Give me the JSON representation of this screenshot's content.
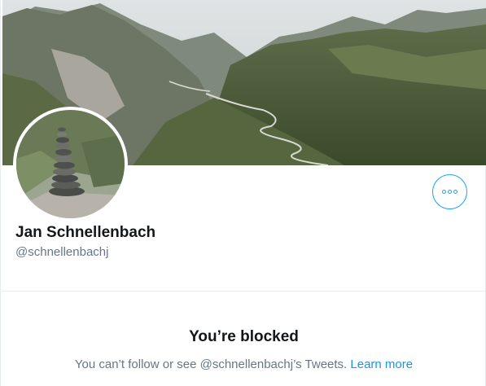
{
  "profile": {
    "name": "Jan Schnellenbach",
    "handle": "@schnellenbachj",
    "more_icon": "more-horizontal-icon"
  },
  "blocked": {
    "title": "You’re blocked",
    "message_prefix": "You can’t follow or see ",
    "message_handle": "@schnellenbachj",
    "message_suffix": "’s Tweets. ",
    "learn_more": "Learn more"
  },
  "colors": {
    "accent": "#1da1f2",
    "link": "#1b95e0",
    "text_primary": "#14171a",
    "text_secondary": "#657786",
    "divider": "#e6ecf0"
  }
}
